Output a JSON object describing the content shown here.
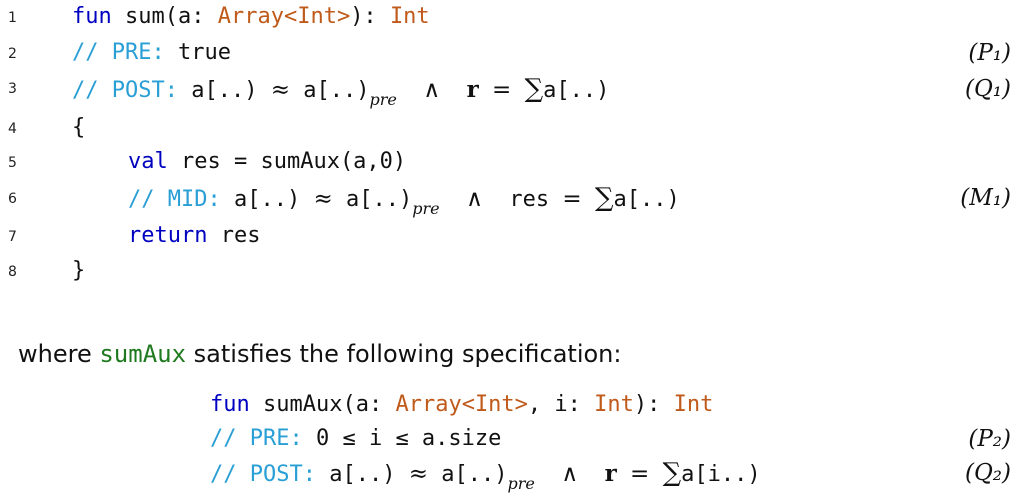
{
  "line_numbers": [
    "1",
    "2",
    "3",
    "4",
    "5",
    "6",
    "7",
    "8"
  ],
  "code": {
    "l1": {
      "fun": "fun",
      "name": "sum(a:",
      "type1": "Array<Int>",
      "rest": "):",
      "type2": "Int"
    },
    "l2": {
      "comment": "// PRE:",
      "value": "true",
      "tag": "(P₁)"
    },
    "l3": {
      "comment": "// POST:",
      "a1": "a[..)",
      "approx": "≈",
      "a2": "a[..)",
      "pre": "pre",
      "and": "∧",
      "r": "r",
      "eq": "=",
      "sum": "∑",
      "a3": "a[..)",
      "tag": "(Q₁)"
    },
    "l4": {
      "brace": "{"
    },
    "l5": {
      "val": "val",
      "rest": "res = sumAux(a,0)"
    },
    "l6": {
      "comment": "// MID:",
      "a1": "a[..)",
      "approx": "≈",
      "a2": "a[..)",
      "pre": "pre",
      "and": "∧",
      "res": "res",
      "eq": "=",
      "sum": "∑",
      "a3": "a[..)",
      "tag": "(M₁)"
    },
    "l7": {
      "ret": "return",
      "rest": "res"
    },
    "l8": {
      "brace": "}"
    }
  },
  "prose": {
    "before": "where ",
    "fn": "sumAux",
    "after": " satisfies the following specification:"
  },
  "spec": {
    "s1": {
      "fun": "fun",
      "name": "sumAux(a:",
      "type1": "Array<Int>",
      "mid": ", i:",
      "type2": "Int",
      "end": "):",
      "type3": "Int"
    },
    "s2": {
      "comment": "// PRE:",
      "expr": "0 ≤ i ≤ a.size",
      "tag": "(P₂)"
    },
    "s3": {
      "comment": "// POST:",
      "a1": "a[..)",
      "approx": "≈",
      "a2": "a[..)",
      "pre": "pre",
      "and": "∧",
      "r": "r",
      "eq": "=",
      "sum": "∑",
      "a3": "a[i..)",
      "tag": "(Q₂)"
    }
  }
}
